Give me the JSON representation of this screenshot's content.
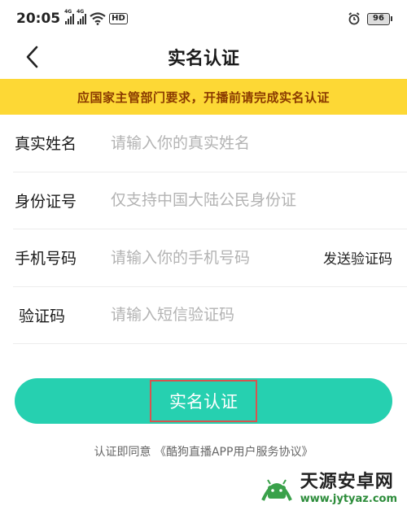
{
  "status_bar": {
    "time": "20:05",
    "signal1_label": "4G",
    "signal2_label": "4G",
    "network_label": "HD",
    "battery": "96"
  },
  "header": {
    "title": "实名认证"
  },
  "notice": {
    "text": "应国家主管部门要求，开播前请完成实名认证"
  },
  "form": {
    "name_label": "真实姓名",
    "name_placeholder": "请输入你的真实姓名",
    "id_label": "身份证号",
    "id_placeholder": "仅支持中国大陆公民身份证",
    "phone_label": "手机号码",
    "phone_placeholder": "请输入你的手机号码",
    "send_code_label": "发送验证码",
    "code_label": "验证码",
    "code_placeholder": "请输入短信验证码"
  },
  "submit": {
    "label": "实名认证"
  },
  "agreement": {
    "prefix": "认证即同意",
    "link": "《酷狗直播APP用户服务协议》"
  },
  "watermark": {
    "title": "天源安卓网",
    "url": "www.jytyaz.com"
  },
  "colors": {
    "accent": "#26d0b0",
    "notice_bg": "#fdd835",
    "notice_text": "#8a3a00",
    "highlight_box": "#d9534f"
  }
}
